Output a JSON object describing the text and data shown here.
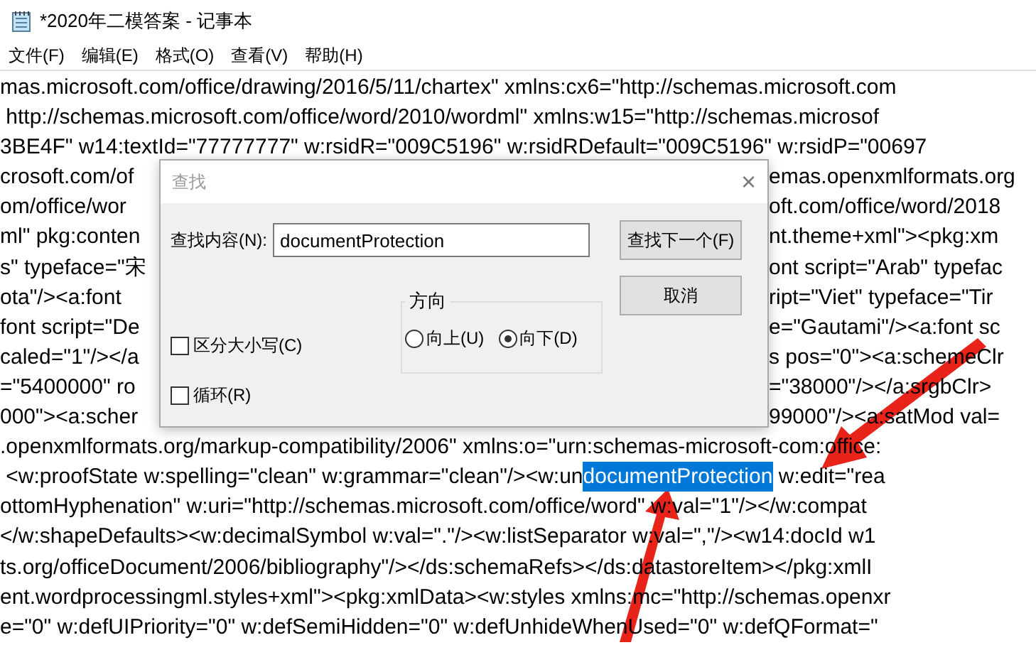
{
  "window": {
    "title": "*2020年二模答案 - 记事本"
  },
  "menu": [
    "文件(F)",
    "编辑(E)",
    "格式(O)",
    "查看(V)",
    "帮助(H)"
  ],
  "lines": [
    {
      "kind": "plain",
      "text": "mas.microsoft.com/office/drawing/2016/5/11/chartex\" xmlns:cx6=\"http://schemas.microsoft.com"
    },
    {
      "kind": "plain",
      "text": " http://schemas.microsoft.com/office/word/2010/wordml\" xmlns:w15=\"http://schemas.microsof"
    },
    {
      "kind": "plain",
      "text": "3BE4F\" w14:textId=\"77777777\" w:rsidR=\"009C5196\" w:rsidRDefault=\"009C5196\" w:rsidP=\"00697"
    },
    {
      "kind": "split",
      "left": "crosoft.com/of",
      "right": "emas.openxmlformats.org"
    },
    {
      "kind": "split",
      "left": "om/office/wor",
      "right": "oft.com/office/word/2018"
    },
    {
      "kind": "split",
      "left": "ml\" pkg:conten",
      "right": "nt.theme+xml\"><pkg:xm"
    },
    {
      "kind": "split",
      "left": "s\" typeface=\"宋",
      "right": "ont script=\"Arab\" typefac"
    },
    {
      "kind": "split",
      "left": "ota\"/><a:font",
      "right": "ript=\"Viet\" typeface=\"Tir"
    },
    {
      "kind": "split",
      "left": "font script=\"De",
      "right": "e=\"Gautami\"/><a:font sc"
    },
    {
      "kind": "split",
      "left": "caled=\"1\"/></a",
      "right": "s pos=\"0\"><a:schemeClr"
    },
    {
      "kind": "split",
      "left": "=\"5400000\" ro",
      "right": "=\"38000\"/></a:srgbClr>"
    },
    {
      "kind": "split",
      "left": "000\"><a:scher",
      "right": "99000\"/><a:satMod val="
    },
    {
      "kind": "plain",
      "text": ".openxmlformats.org/markup-compatibility/2006\" xmlns:o=\"urn:schemas-microsoft-com:office:"
    },
    {
      "kind": "match",
      "before": " <w:proofState w:spelling=\"clean\" w:grammar=\"clean\"/><w:un",
      "match": "documentProtection",
      "after": " w:edit=\"rea"
    },
    {
      "kind": "plain",
      "text": "ottomHyphenation\" w:uri=\"http://schemas.microsoft.com/office/word\" w:val=\"1\"/></w:compat"
    },
    {
      "kind": "plain",
      "text": "</w:shapeDefaults><w:decimalSymbol w:val=\".\"/><w:listSeparator w:val=\",\"/><w14:docId w1"
    },
    {
      "kind": "plain",
      "text": "ts.org/officeDocument/2006/bibliography\"/></ds:schemaRefs></ds:datastoreItem></pkg:xmlI"
    },
    {
      "kind": "plain",
      "text": "ent.wordprocessingml.styles+xml\"><pkg:xmlData><w:styles xmlns:mc=\"http://schemas.openxr"
    },
    {
      "kind": "plain",
      "text": "e=\"0\" w:defUIPriority=\"0\" w:defSemiHidden=\"0\" w:defUnhideWhenUsed=\"0\" w:defQFormat=\""
    }
  ],
  "find_dialog": {
    "title": "查找",
    "close": "×",
    "label": "查找内容(N):",
    "value": "documentProtection",
    "buttons": [
      "查找下一个(F)",
      "取消"
    ],
    "direction": {
      "title": "方向",
      "options": [
        {
          "label": "向上(U)",
          "selected": false
        },
        {
          "label": "向下(D)",
          "selected": true
        }
      ]
    },
    "options": [
      {
        "label": "区分大小写(C)",
        "checked": false
      },
      {
        "label": "循环(R)",
        "checked": false
      }
    ]
  }
}
